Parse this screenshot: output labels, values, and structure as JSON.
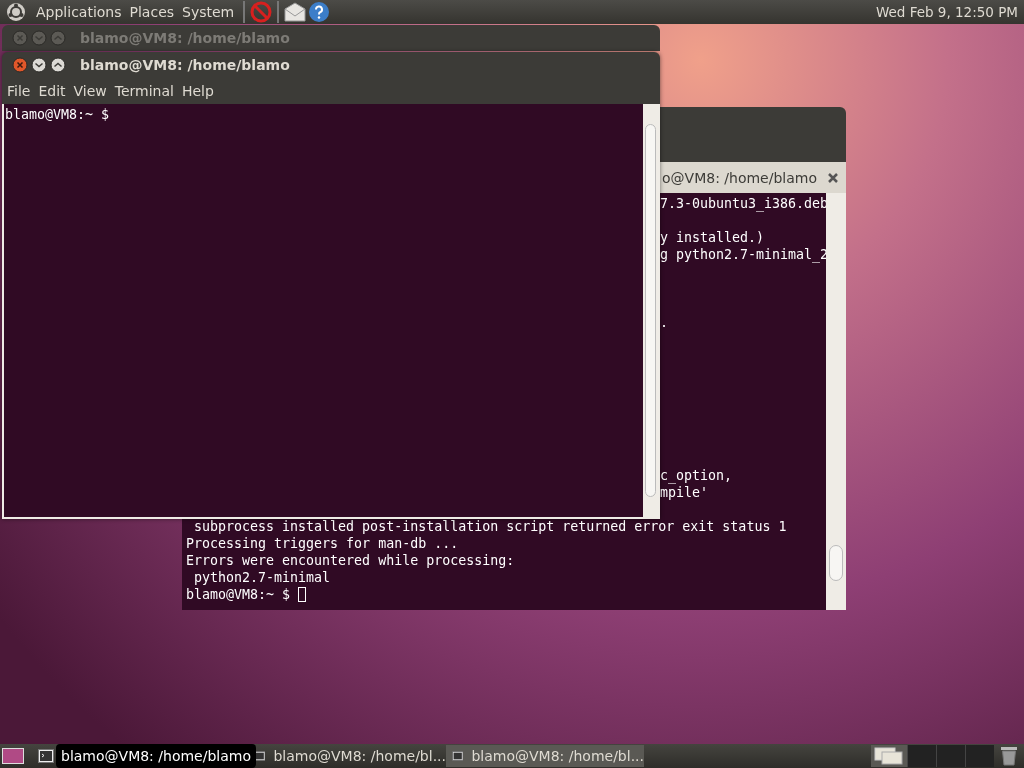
{
  "top_panel": {
    "menus": [
      "Applications",
      "Places",
      "System"
    ],
    "clock": "Wed Feb  9, 12:50 PM"
  },
  "back_window": {
    "tab_title": "o@VM8: /home/blamo",
    "cursor": true,
    "lines": [
      {
        "kind": "partial",
        "text": "7.3-0ubuntu3_i386.deb"
      },
      {
        "kind": "blank"
      },
      {
        "kind": "partial",
        "text": "y installed.)"
      },
      {
        "kind": "partial",
        "text": "g python2.7-minimal_2"
      },
      {
        "kind": "blank"
      },
      {
        "kind": "blank"
      },
      {
        "kind": "blank"
      },
      {
        "kind": "partial",
        "text": "."
      },
      {
        "kind": "blank"
      },
      {
        "kind": "blank"
      },
      {
        "kind": "blank"
      },
      {
        "kind": "blank"
      },
      {
        "kind": "blank"
      },
      {
        "kind": "blank"
      },
      {
        "kind": "blank"
      },
      {
        "kind": "blank"
      },
      {
        "kind": "partial",
        "text": "c_option,"
      },
      {
        "kind": "partial",
        "text": "mpile'"
      },
      {
        "kind": "blank"
      },
      {
        "kind": "full",
        "text": " subprocess installed post-installation script returned error exit status 1"
      },
      {
        "kind": "full",
        "text": "Processing triggers for man-db ..."
      },
      {
        "kind": "full",
        "text": "Errors were encountered while processing:"
      },
      {
        "kind": "full",
        "text": " python2.7-minimal"
      },
      {
        "kind": "prompt",
        "text": "blamo@VM8:~ $"
      }
    ]
  },
  "stacked_window": {
    "title": "blamo@VM8: /home/blamo",
    "focused": false
  },
  "front_window": {
    "title": "blamo@VM8: /home/blamo",
    "focused": true,
    "menu": [
      "File",
      "Edit",
      "View",
      "Terminal",
      "Help"
    ],
    "lines": [
      "blamo@VM8:~ $"
    ]
  },
  "taskbar": {
    "tooltip": "blamo@VM8: /home/blamo",
    "tasks": [
      {
        "label": "blamo@VM8: /home/bl...",
        "selected": false
      },
      {
        "label": "blamo@VM8: /home/bl...",
        "selected": true
      }
    ]
  }
}
